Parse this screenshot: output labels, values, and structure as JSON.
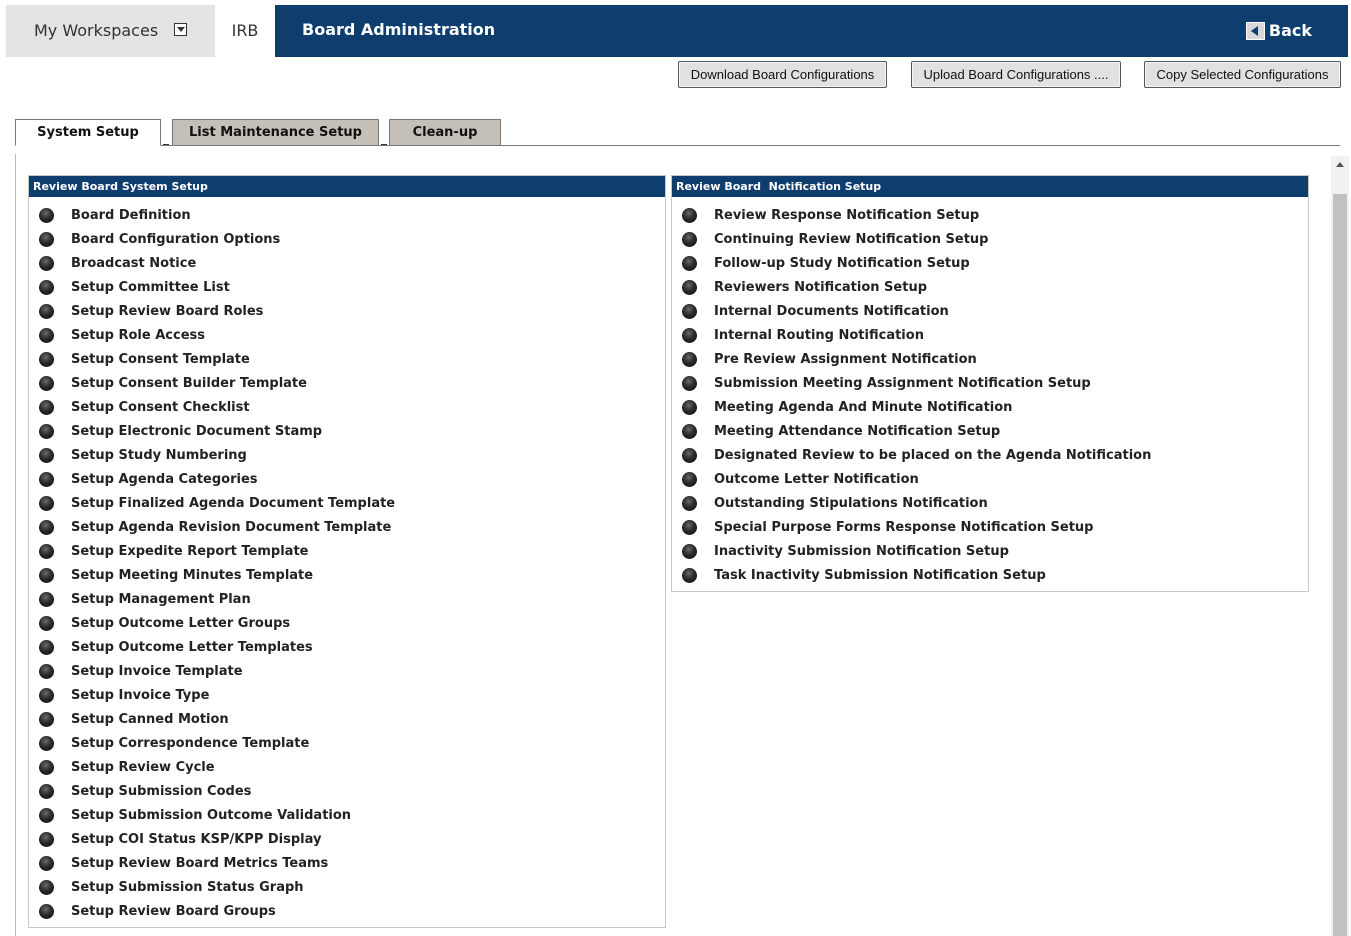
{
  "header": {
    "workspace_label": "My Workspaces",
    "irb_tab": "IRB",
    "title": "Board Administration",
    "back_label": "Back"
  },
  "actions": {
    "download": "Download Board Configurations",
    "upload": "Upload Board Configurations ....",
    "copy": "Copy Selected Configurations"
  },
  "tabs": [
    {
      "label": "System Setup",
      "active": true
    },
    {
      "label": "List Maintenance Setup",
      "active": false
    },
    {
      "label": "Clean-up",
      "active": false
    }
  ],
  "system_setup": {
    "title": "Review Board System Setup",
    "items": [
      "Board Definition",
      "Board Configuration Options",
      "Broadcast Notice",
      "Setup Committee List",
      "Setup Review Board Roles",
      "Setup Role Access",
      "Setup Consent Template",
      "Setup Consent Builder Template",
      "Setup Consent Checklist",
      "Setup Electronic Document Stamp",
      "Setup Study Numbering",
      "Setup Agenda Categories",
      "Setup Finalized Agenda Document Template",
      "Setup Agenda Revision Document Template",
      "Setup Expedite Report Template",
      "Setup Meeting Minutes Template",
      "Setup Management Plan",
      "Setup Outcome Letter Groups",
      "Setup Outcome Letter Templates",
      "Setup Invoice Template",
      "Setup Invoice Type",
      "Setup Canned Motion",
      "Setup Correspondence Template",
      "Setup Review Cycle",
      "Setup Submission Codes",
      "Setup Submission Outcome Validation",
      "Setup COI Status KSP/KPP Display",
      "Setup Review Board Metrics Teams",
      "Setup Submission Status Graph",
      "Setup Review Board Groups"
    ]
  },
  "notification_setup": {
    "title": "Review Board  Notification Setup",
    "items": [
      "Review Response Notification Setup",
      "Continuing Review Notification Setup",
      "Follow-up Study Notification Setup",
      "Reviewers Notification Setup",
      "Internal Documents Notification",
      "Internal Routing Notification",
      "Pre Review Assignment Notification",
      "Submission Meeting Assignment Notification Setup",
      "Meeting Agenda And Minute Notification",
      "Meeting Attendance Notification Setup",
      "Designated Review to be placed on the Agenda Notification",
      "Outcome Letter Notification",
      "Outstanding Stipulations Notification",
      "Special Purpose Forms Response Notification Setup",
      "Inactivity Submission Notification Setup",
      "Task Inactivity Submission Notification Setup"
    ]
  },
  "colors": {
    "header_bg": "#0f3d6e",
    "tab_inactive_bg": "#c4c0b8",
    "button_bg": "#e1e1e1"
  }
}
